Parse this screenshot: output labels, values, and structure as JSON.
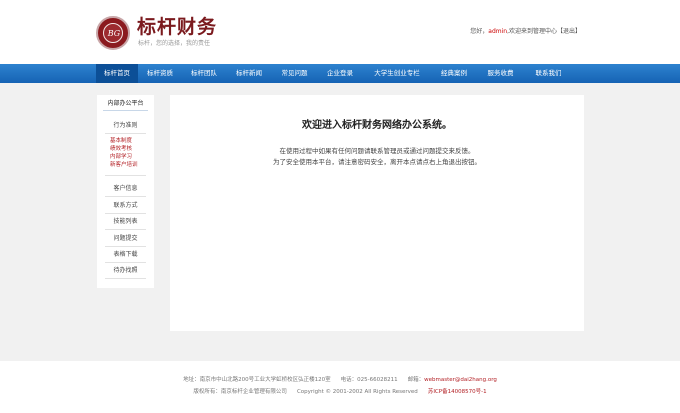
{
  "header": {
    "brand": "标杆财务",
    "slogan": "标杆，您的选择，我的责任",
    "welcome_prefix": "您好，",
    "user": "admin",
    "welcome_suffix": ",欢迎来到管理中心【退出】"
  },
  "nav": {
    "items": [
      {
        "label": "标杆首页",
        "active": true
      },
      {
        "label": "标杆资质"
      },
      {
        "label": "标杆团队"
      },
      {
        "label": "标杆新闻"
      },
      {
        "label": "常见问题"
      },
      {
        "label": "企业登录"
      },
      {
        "label": "大学生创业专栏"
      },
      {
        "label": "经典案例"
      },
      {
        "label": "服务收费"
      },
      {
        "label": "联系我们"
      }
    ]
  },
  "sidebar": {
    "title": "内部办公平台",
    "group_rules": "行为准则",
    "sub_items": [
      "基本制度",
      "绩效考核",
      "内部学习",
      "新客户培训"
    ],
    "items": [
      "客户信息",
      "联系方式",
      "技能列表",
      "问题提交",
      "表格下载",
      "待办找照"
    ]
  },
  "main": {
    "title": "欢迎进入标杆财务网络办公系统。",
    "line1": "在使用过程中如果有任何问题请联系管理员或通过问题提交来反馈。",
    "line2": "为了安全使用本平台，请注意密码安全，离开本点请点右上角退出按钮。"
  },
  "footer": {
    "address": "地址：南京市中山北路200号工业大学虹桥校区弘正楼120室",
    "phone": "电话：025-66028211",
    "email_label": "邮箱：",
    "email": "webmaster@dai2hang.org",
    "copyright": "版权所有：南京标杆企业管理有限公司",
    "copyright_years": "Copyright © 2001-2002 All Rights Reserved",
    "icp": "苏ICP备14008570号-1"
  }
}
